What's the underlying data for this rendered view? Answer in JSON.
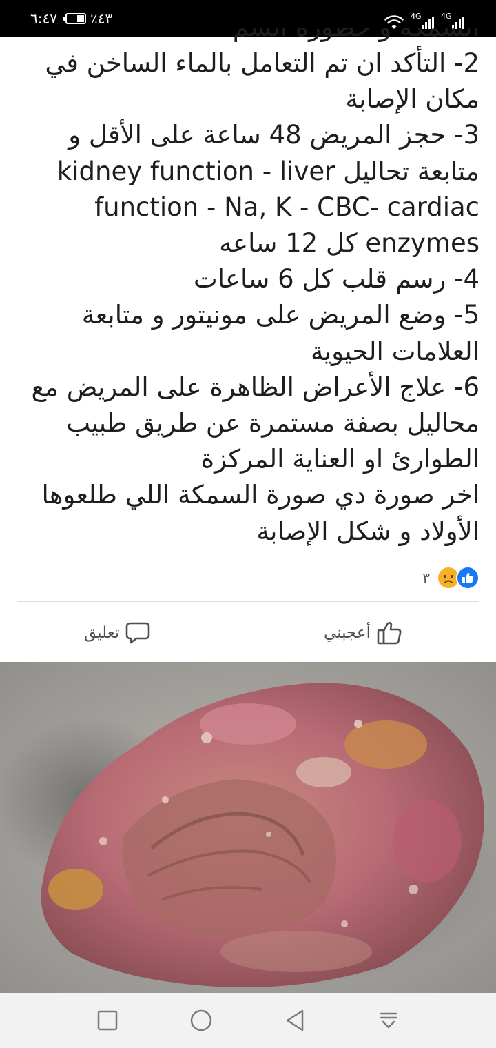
{
  "status_bar": {
    "time": "٦:٤٧",
    "battery_percent": "٪٤٣",
    "battery_level": 0.43,
    "network_1": "4G",
    "network_2": "4G"
  },
  "post": {
    "lines": [
      "السمكة و خطورة السم",
      "2- التأكد ان تم التعامل بالماء الساخن في",
      "مكان الإصابة",
      "3- حجز المريض 48 ساعة على الأقل و",
      "متابعة تحاليل kidney function - liver",
      "function - Na, K - CBC- cardiac",
      "enzymes كل 12 ساعه",
      "4- رسم قلب كل 6 ساعات",
      "5- وضع المريض على مونيتور و متابعة",
      "العلامات الحيوية",
      "6- علاج الأعراض الظاهرة على المريض مع",
      "محاليل بصفة مستمرة عن طريق طبيب",
      "الطوارئ او العناية المركزة",
      "اخر صورة دي صورة السمكة اللي طلعوها",
      "الأولاد و شكل الإصابة"
    ]
  },
  "reactions": {
    "count": "٣",
    "types": [
      "like-icon",
      "sad-icon"
    ]
  },
  "actions": {
    "like_label": "أعجبني",
    "comment_label": "تعليق"
  },
  "photo": {
    "subject": "stonefish-photo"
  },
  "nav": {
    "buttons": [
      "recent-apps-icon",
      "home-icon",
      "back-icon",
      "notification-pulldown-icon"
    ]
  },
  "colors": {
    "status_bar": "#000000",
    "text": "#1c1e21",
    "secondary_text": "#4b4f56",
    "like_blue": "#1877f2",
    "sad_yellow": "#f7b125",
    "nav_background": "#f2f2f2"
  }
}
